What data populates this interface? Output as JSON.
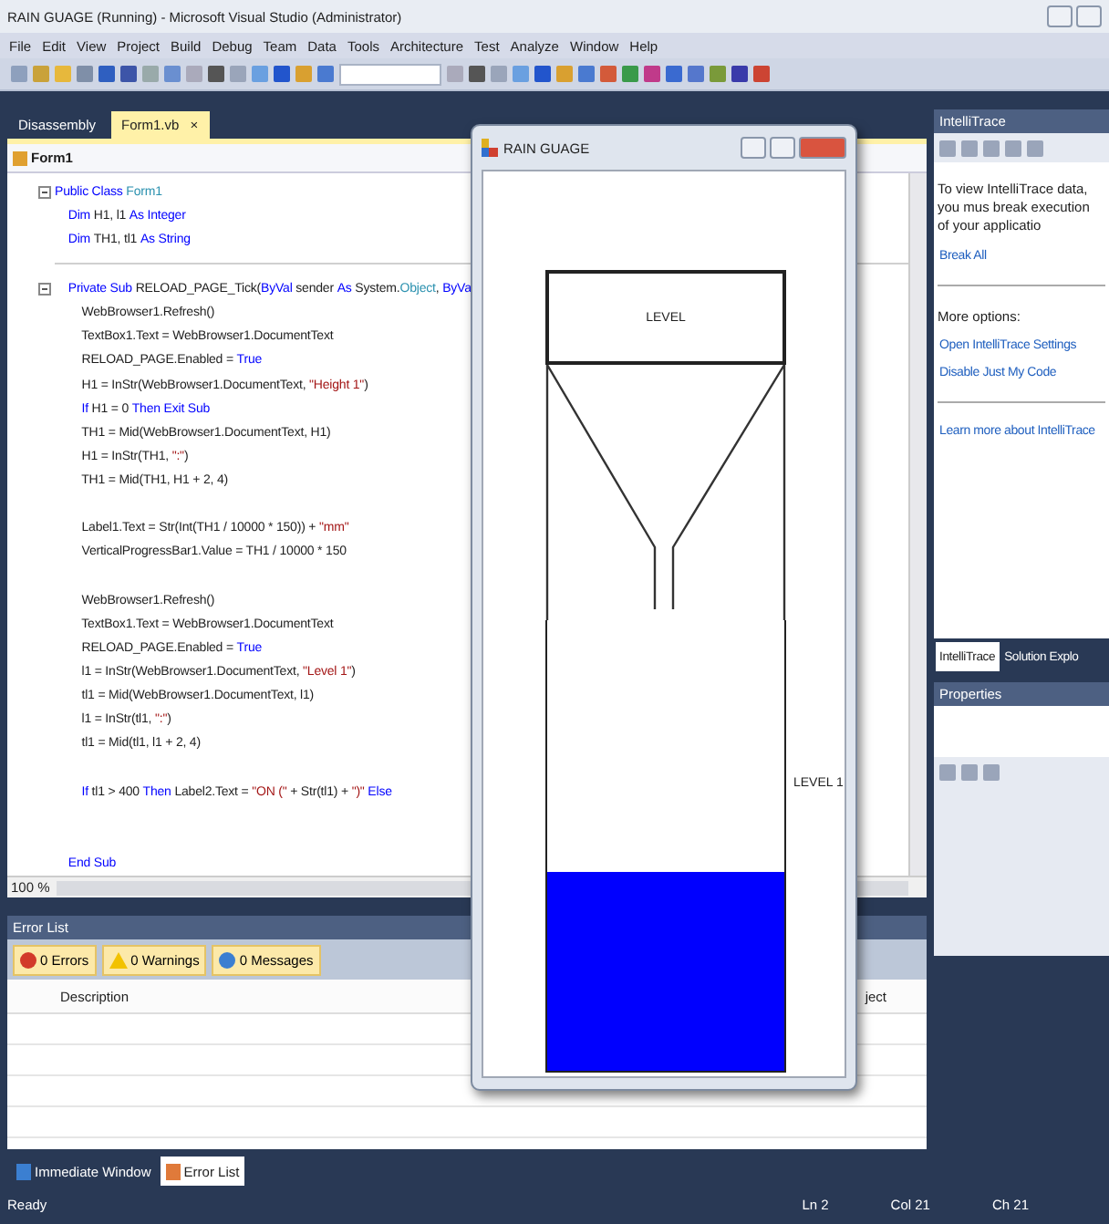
{
  "window": {
    "title": "RAIN GUAGE (Running) - Microsoft Visual Studio (Administrator)"
  },
  "menu": [
    "File",
    "Edit",
    "View",
    "Project",
    "Build",
    "Debug",
    "Team",
    "Data",
    "Tools",
    "Architecture",
    "Test",
    "Analyze",
    "Window",
    "Help"
  ],
  "doc_tabs": [
    {
      "label": "Disassembly",
      "selected": false
    },
    {
      "label": "Form1.vb",
      "selected": true,
      "close": "×"
    }
  ],
  "editor": {
    "class_combo": "Form1",
    "zoom": "100 %",
    "lines": [
      {
        "kind": "fold",
        "segs": [
          {
            "t": "Public Class ",
            "kind": "keyword"
          },
          {
            "t": "Form1",
            "kind": "type"
          }
        ]
      },
      {
        "kind": "code",
        "segs": [
          {
            "t": "    Dim ",
            "kind": "keyword"
          },
          {
            "t": "H1, l1 ",
            "kind": "plain"
          },
          {
            "t": "As Integer",
            "kind": "keyword"
          }
        ]
      },
      {
        "kind": "code",
        "segs": [
          {
            "t": "    Dim ",
            "kind": "keyword"
          },
          {
            "t": "TH1, tl1 ",
            "kind": "plain"
          },
          {
            "t": "As String",
            "kind": "keyword"
          }
        ]
      },
      {
        "kind": "separator"
      },
      {
        "kind": "fold",
        "segs": [
          {
            "t": "    Private Sub ",
            "kind": "keyword"
          },
          {
            "t": "RELOAD_PAGE_Tick(",
            "kind": "plain"
          },
          {
            "t": "ByVal",
            "kind": "keyword"
          },
          {
            "t": " sender ",
            "kind": "plain"
          },
          {
            "t": "As",
            "kind": "keyword"
          },
          {
            "t": " System.",
            "kind": "plain"
          },
          {
            "t": "Object",
            "kind": "type"
          },
          {
            "t": ", ",
            "kind": "plain"
          },
          {
            "t": "ByVa",
            "kind": "keyword"
          }
        ]
      },
      {
        "kind": "code",
        "segs": [
          {
            "t": "        WebBrowser1.Refresh()",
            "kind": "plain"
          }
        ]
      },
      {
        "kind": "code",
        "segs": [
          {
            "t": "        TextBox1.Text = WebBrowser1.DocumentText",
            "kind": "plain"
          }
        ]
      },
      {
        "kind": "code",
        "segs": [
          {
            "t": "        RELOAD_PAGE.Enabled = ",
            "kind": "plain"
          },
          {
            "t": "True",
            "kind": "keyword"
          }
        ]
      },
      {
        "kind": "code",
        "segs": [
          {
            "t": "        H1 = InStr(WebBrowser1.DocumentText, ",
            "kind": "plain"
          },
          {
            "t": "\"Height 1\"",
            "kind": "string"
          },
          {
            "t": ")",
            "kind": "plain"
          }
        ]
      },
      {
        "kind": "code",
        "segs": [
          {
            "t": "        If ",
            "kind": "keyword"
          },
          {
            "t": "H1 = 0 ",
            "kind": "plain"
          },
          {
            "t": "Then Exit Sub",
            "kind": "keyword"
          }
        ]
      },
      {
        "kind": "code",
        "segs": [
          {
            "t": "        TH1 = Mid(WebBrowser1.DocumentText, H1)",
            "kind": "plain"
          }
        ]
      },
      {
        "kind": "code",
        "segs": [
          {
            "t": "        H1 = InStr(TH1, ",
            "kind": "plain"
          },
          {
            "t": "\":\"",
            "kind": "string"
          },
          {
            "t": ")",
            "kind": "plain"
          }
        ]
      },
      {
        "kind": "code",
        "segs": [
          {
            "t": "        TH1 = Mid(TH1, H1 + 2, 4)",
            "kind": "plain"
          }
        ]
      },
      {
        "kind": "blank"
      },
      {
        "kind": "code",
        "segs": [
          {
            "t": "        Label1.Text = Str(Int(TH1 / 10000 * 150)) + ",
            "kind": "plain"
          },
          {
            "t": "\"mm\"",
            "kind": "string"
          }
        ]
      },
      {
        "kind": "code",
        "segs": [
          {
            "t": "        VerticalProgressBar1.Value = TH1 / 10000 * 150",
            "kind": "plain"
          }
        ]
      },
      {
        "kind": "blank"
      },
      {
        "kind": "code",
        "segs": [
          {
            "t": "        WebBrowser1.Refresh()",
            "kind": "plain"
          }
        ]
      },
      {
        "kind": "code",
        "segs": [
          {
            "t": "        TextBox1.Text = WebBrowser1.DocumentText",
            "kind": "plain"
          }
        ]
      },
      {
        "kind": "code",
        "segs": [
          {
            "t": "        RELOAD_PAGE.Enabled = ",
            "kind": "plain"
          },
          {
            "t": "True",
            "kind": "keyword"
          }
        ]
      },
      {
        "kind": "code",
        "segs": [
          {
            "t": "        l1 = InStr(WebBrowser1.DocumentText, ",
            "kind": "plain"
          },
          {
            "t": "\"Level 1\"",
            "kind": "string"
          },
          {
            "t": ")",
            "kind": "plain"
          }
        ]
      },
      {
        "kind": "code",
        "segs": [
          {
            "t": "        tl1 = Mid(WebBrowser1.DocumentText, l1)",
            "kind": "plain"
          }
        ]
      },
      {
        "kind": "code",
        "segs": [
          {
            "t": "        l1 = InStr(tl1, ",
            "kind": "plain"
          },
          {
            "t": "\":\"",
            "kind": "string"
          },
          {
            "t": ")",
            "kind": "plain"
          }
        ]
      },
      {
        "kind": "code",
        "segs": [
          {
            "t": "        tl1 = Mid(tl1, l1 + 2, 4)",
            "kind": "plain"
          }
        ]
      },
      {
        "kind": "blank"
      },
      {
        "kind": "code",
        "segs": [
          {
            "t": "        If ",
            "kind": "keyword"
          },
          {
            "t": "tl1 > 400 ",
            "kind": "plain"
          },
          {
            "t": "Then ",
            "kind": "keyword"
          },
          {
            "t": "Label2.Text = ",
            "kind": "plain"
          },
          {
            "t": "\"ON (\"",
            "kind": "string"
          },
          {
            "t": " + Str(tl1) + ",
            "kind": "plain"
          },
          {
            "t": "\")\"",
            "kind": "string"
          },
          {
            "t": " Else",
            "kind": "keyword"
          }
        ]
      },
      {
        "kind": "blank"
      },
      {
        "kind": "blank"
      },
      {
        "kind": "code",
        "segs": [
          {
            "t": "    End Sub",
            "kind": "keyword"
          }
        ]
      }
    ]
  },
  "error_list": {
    "title": "Error List",
    "filters": [
      {
        "kind": "error",
        "label": "0 Errors"
      },
      {
        "kind": "warning",
        "label": "0 Warnings"
      },
      {
        "kind": "info",
        "label": "0 Messages"
      }
    ],
    "columns": [
      "Description",
      "ject"
    ]
  },
  "bottom_tabs": [
    {
      "label": "Immediate Window",
      "selected": false
    },
    {
      "label": "Error List",
      "selected": true
    }
  ],
  "intellitrace": {
    "title": "IntelliTrace",
    "intro": "To view IntelliTrace data, you mus break execution of your applicatio",
    "break_all": "Break All",
    "more_options": "More options:",
    "links": [
      "Open IntelliTrace Settings",
      "Disable Just My Code"
    ],
    "learn_more": "Learn more about IntelliTrace"
  },
  "side_tabs": [
    {
      "label": "IntelliTrace",
      "selected": true
    },
    {
      "label": "Solution Explo",
      "selected": false
    }
  ],
  "properties": {
    "title": "Properties"
  },
  "form": {
    "title": "RAIN GUAGE",
    "box_label": "LEVEL",
    "gauge": {
      "level": 0.44
    },
    "level_label": "LEVEL 1"
  },
  "status_bar": {
    "text": "Ready",
    "ln": "Ln 2",
    "col": "Col 21",
    "ch": "Ch 21"
  }
}
